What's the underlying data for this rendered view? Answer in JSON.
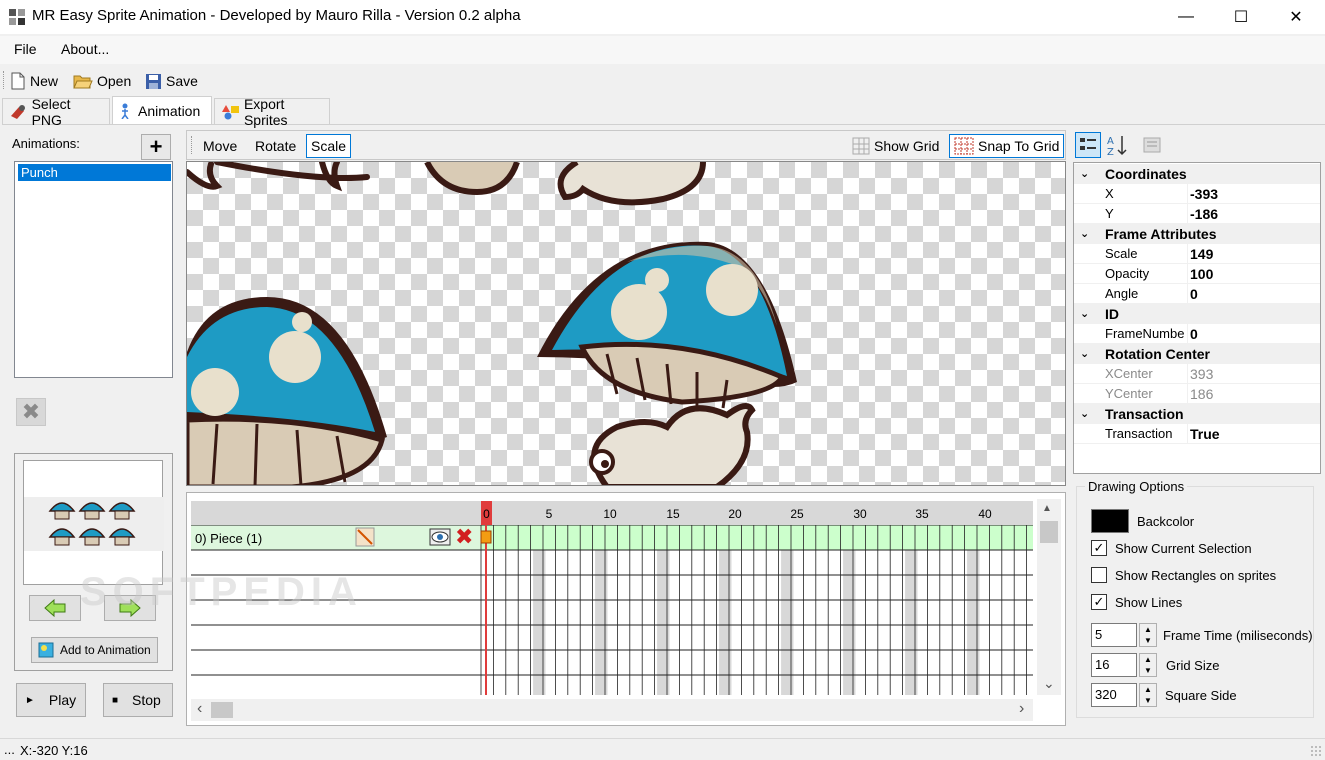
{
  "window": {
    "title": "MR Easy Sprite Animation - Developed by Mauro Rilla - Version 0.2 alpha",
    "minimize_glyph": "—",
    "maximize_glyph": "☐",
    "close_glyph": "✕"
  },
  "menu": {
    "file": "File",
    "about": "About..."
  },
  "toolbar": {
    "new": "New",
    "open": "Open",
    "save": "Save"
  },
  "tabs": [
    {
      "label": "Select PNG",
      "icon": "puzzle-icon"
    },
    {
      "label": "Animation",
      "icon": "figure-icon",
      "active": true
    },
    {
      "label": "Export Sprites",
      "icon": "shapes-icon"
    }
  ],
  "animations": {
    "label": "Animations:",
    "add_glyph": "+",
    "delete_glyph": "✖",
    "items": [
      "Punch"
    ],
    "selected": "Punch"
  },
  "sprite_panel": {
    "add_to_animation": "Add to Animation"
  },
  "playback": {
    "play": "Play",
    "stop": "Stop",
    "play_glyph": "►",
    "stop_glyph": "■"
  },
  "canvas_toolbar": {
    "move": "Move",
    "rotate": "Rotate",
    "scale": "Scale",
    "selected_tool": "Scale",
    "show_grid": "Show Grid",
    "snap_to_grid": "Snap To Grid"
  },
  "timeline": {
    "ticks": [
      "0",
      "5",
      "10",
      "15",
      "20",
      "25",
      "30",
      "35",
      "40"
    ],
    "layers": [
      {
        "name": "0) Piece (1)",
        "delete_glyph": "✖"
      }
    ],
    "current_frame": 0,
    "frame_count": 44,
    "scroll_up_glyph": "▲",
    "scroll_down_glyph": "⌄",
    "scroll_left_glyph": "‹",
    "scroll_right_glyph": "›"
  },
  "properties": {
    "categories": [
      {
        "name": "Coordinates",
        "rows": [
          {
            "name": "X",
            "value": "-393"
          },
          {
            "name": "Y",
            "value": "-186"
          }
        ]
      },
      {
        "name": "Frame Attributes",
        "rows": [
          {
            "name": "Scale",
            "value": "149"
          },
          {
            "name": "Opacity",
            "value": "100"
          },
          {
            "name": "Angle",
            "value": "0"
          }
        ]
      },
      {
        "name": "ID",
        "rows": [
          {
            "name": "FrameNumbe",
            "value": "0"
          }
        ]
      },
      {
        "name": "Rotation Center",
        "rows": [
          {
            "name": "XCenter",
            "value": "393",
            "disabled": true
          },
          {
            "name": "YCenter",
            "value": "186",
            "disabled": true
          }
        ]
      },
      {
        "name": "Transaction",
        "rows": [
          {
            "name": "Transaction",
            "value": "True"
          }
        ]
      }
    ]
  },
  "drawing_options": {
    "legend": "Drawing Options",
    "backcolor_label": "Backcolor",
    "backcolor": "#000000",
    "checkbox_glyph": "✓",
    "spin_up_glyph": "▲",
    "spin_down_glyph": "▼",
    "show_current_selection": {
      "label": "Show Current Selection",
      "checked": true
    },
    "show_rectangles": {
      "label": "Show Rectangles on sprites",
      "checked": false
    },
    "show_lines": {
      "label": "Show Lines",
      "checked": true
    },
    "frame_time": {
      "label": "Frame Time (miliseconds)",
      "value": "5"
    },
    "grid_size": {
      "label": "Grid Size",
      "value": "16"
    },
    "square_side": {
      "label": "Square Side",
      "value": "320"
    }
  },
  "status": {
    "prefix": "...",
    "coords": "X:-320 Y:16"
  },
  "watermark": "SOFTPEDIA",
  "colors": {
    "accent": "#0078d7",
    "timeline_frame": "#ccffcc",
    "current_frame": "#e03c3c",
    "mushroom_blue": "#1e9bc4",
    "outline": "#3a1a14"
  }
}
